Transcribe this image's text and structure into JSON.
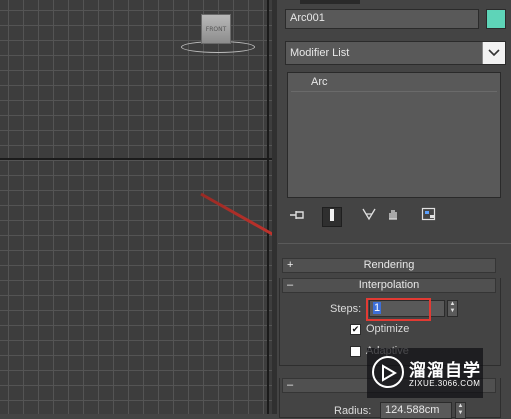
{
  "viewport": {
    "viewcube_label": "FRONT"
  },
  "panel": {
    "object_name": "Arc001",
    "object_color": "#5ed4b8",
    "modifier_list_label": "Modifier List",
    "modifier_stack": [
      "Arc"
    ],
    "stack_tool_icons": [
      "pin-stack-icon",
      "show-end-result-icon",
      "make-unique-icon",
      "remove-modifier-icon",
      "configure-modifier-sets-icon"
    ]
  },
  "rollouts": {
    "rendering": {
      "toggle": "+",
      "title": "Rendering"
    },
    "interpolation": {
      "toggle": "–",
      "title": "Interpolation",
      "steps_label": "Steps:",
      "steps_value": "1",
      "optimize_label": "Optimize",
      "optimize_checked": true,
      "adaptive_label": "Adaptive",
      "adaptive_checked": false
    },
    "parameters": {
      "toggle": "–",
      "radius_label": "Radius:",
      "radius_value": "124.588cm"
    }
  },
  "annotation": {
    "arrow_color": "#e23a33"
  },
  "watermark": {
    "title": "溜溜自学",
    "url": "ZIXUE.3066.COM"
  }
}
